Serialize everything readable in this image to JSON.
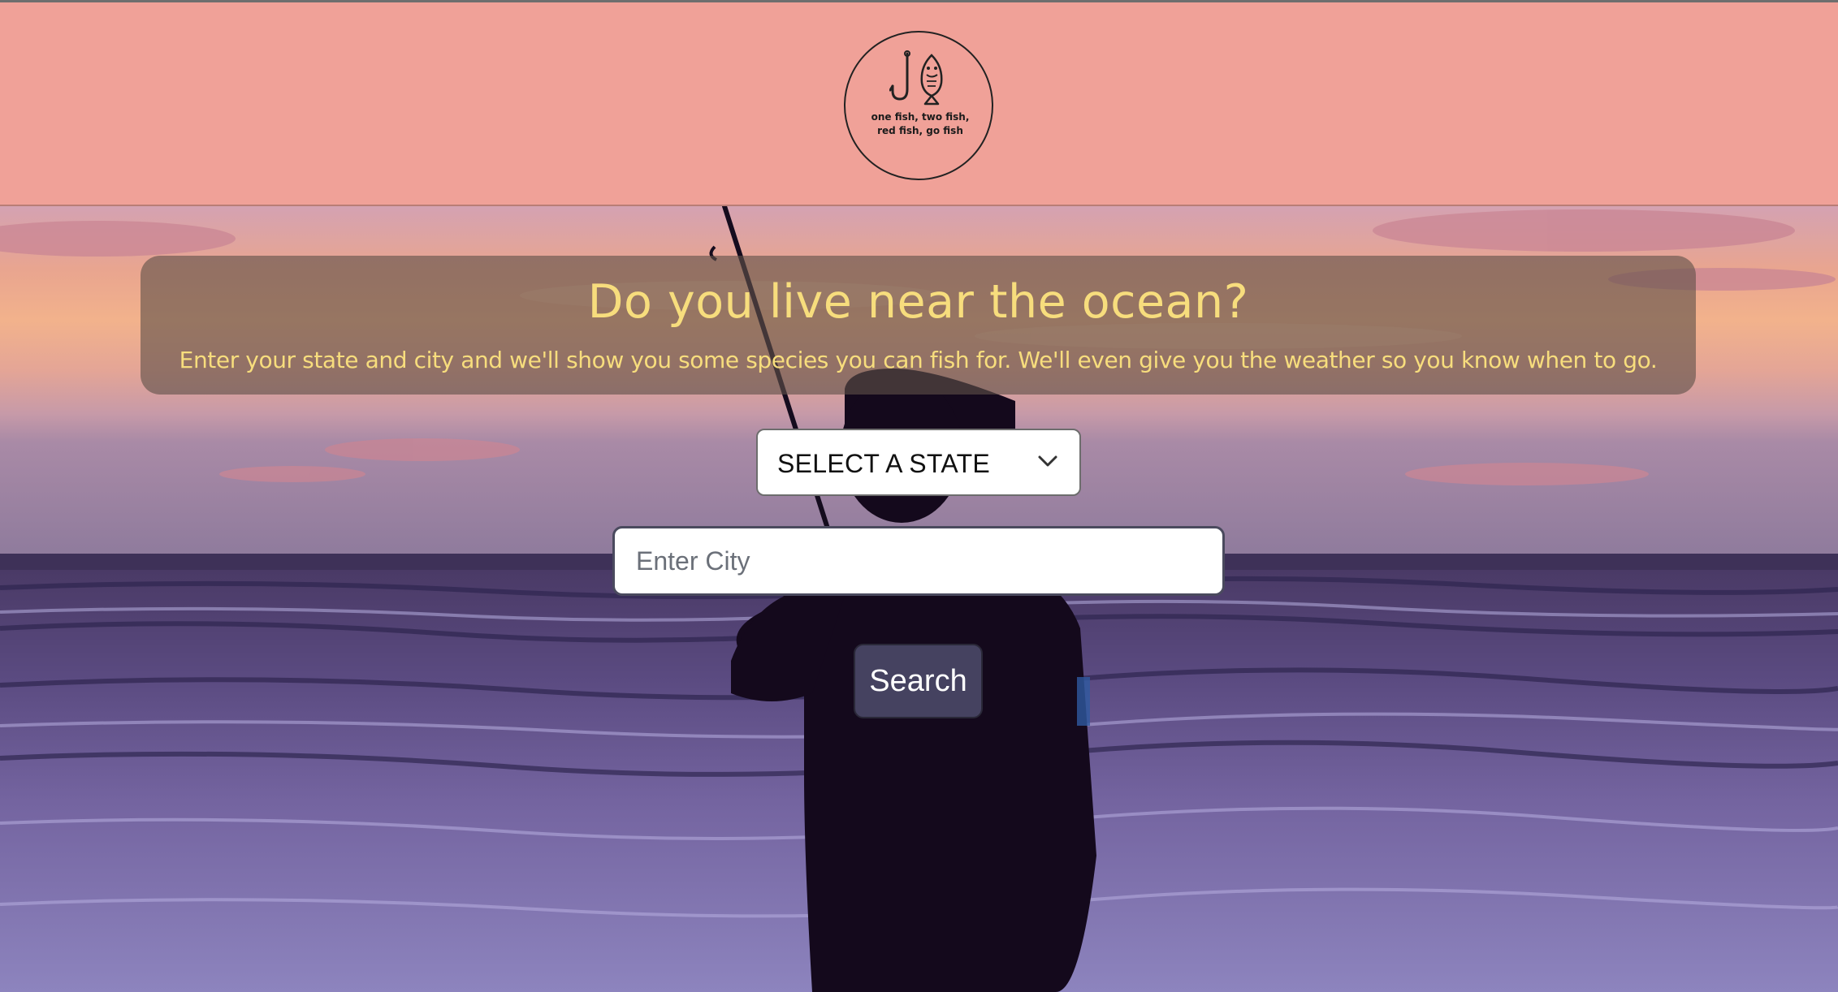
{
  "header": {
    "logo_text": "one fish, two fish, red fish, go fish"
  },
  "hero": {
    "title": "Do you live near the ocean?",
    "subtitle": "Enter your state and city and we'll show you some species you can fish for. We'll even give you the weather so you know when to go."
  },
  "form": {
    "state_select_label": "SELECT A STATE",
    "city_placeholder": "Enter City",
    "search_label": "Search"
  },
  "colors": {
    "header_bg": "#f0a198",
    "headline": "#f7dd7d",
    "button_bg": "#454260"
  },
  "icons": {
    "logo": "hook-and-fish-icon",
    "select": "chevron-down-icon"
  }
}
